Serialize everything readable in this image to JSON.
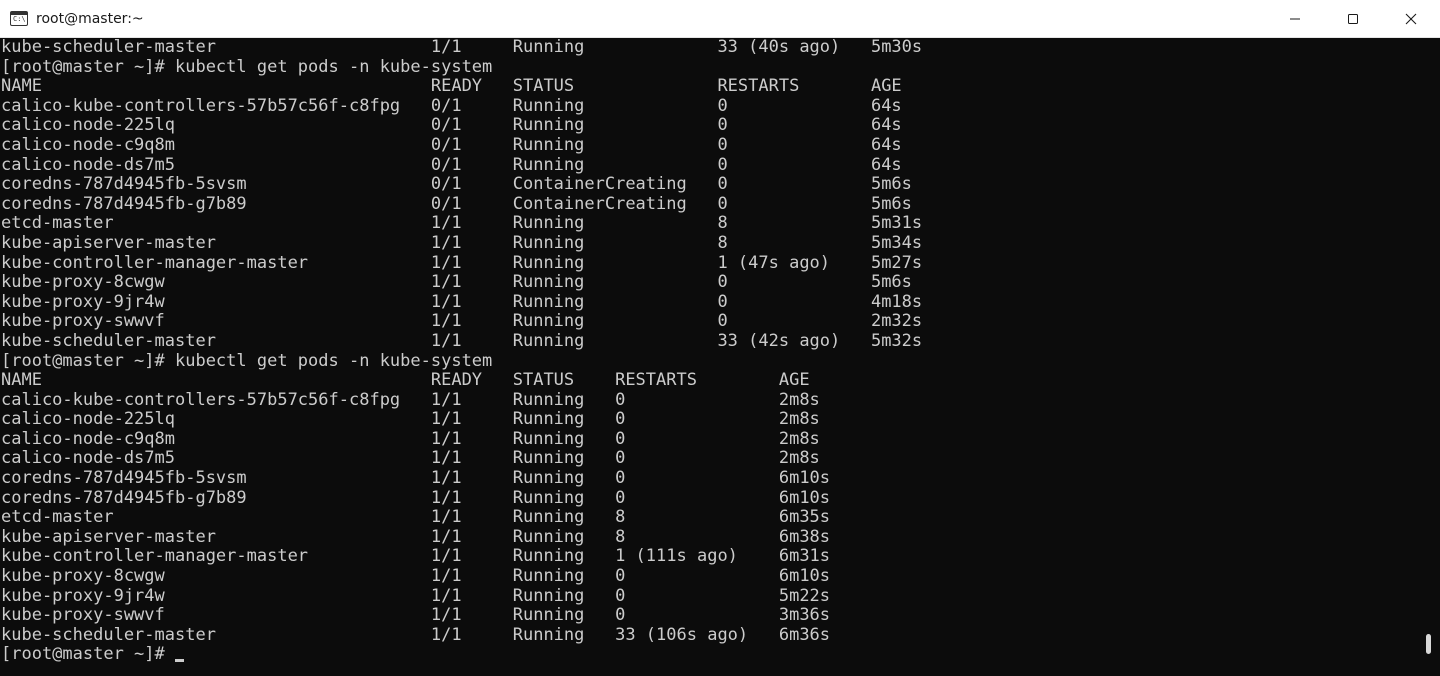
{
  "window": {
    "title": "root@master:~",
    "icon": "terminal-icon",
    "icon_glyph": "C:\\",
    "controls": [
      "minimize-icon",
      "maximize-icon",
      "close-icon"
    ]
  },
  "colors": {
    "background": "#0c0c0c",
    "foreground": "#cccccc",
    "titlebar": "#ffffff"
  },
  "terminal": {
    "lines": [
      "kube-scheduler-master                     1/1     Running             33 (40s ago)   5m30s",
      "[root@master ~]# kubectl get pods -n kube-system",
      "NAME                                      READY   STATUS              RESTARTS       AGE",
      "calico-kube-controllers-57b57c56f-c8fpg   0/1     Running             0              64s",
      "calico-node-225lq                         0/1     Running             0              64s",
      "calico-node-c9q8m                         0/1     Running             0              64s",
      "calico-node-ds7m5                         0/1     Running             0              64s",
      "coredns-787d4945fb-5svsm                  0/1     ContainerCreating   0              5m6s",
      "coredns-787d4945fb-g7b89                  0/1     ContainerCreating   0              5m6s",
      "etcd-master                               1/1     Running             8              5m31s",
      "kube-apiserver-master                     1/1     Running             8              5m34s",
      "kube-controller-manager-master            1/1     Running             1 (47s ago)    5m27s",
      "kube-proxy-8cwgw                          1/1     Running             0              5m6s",
      "kube-proxy-9jr4w                          1/1     Running             0              4m18s",
      "kube-proxy-swwvf                          1/1     Running             0              2m32s",
      "kube-scheduler-master                     1/1     Running             33 (42s ago)   5m32s",
      "[root@master ~]# kubectl get pods -n kube-system",
      "NAME                                      READY   STATUS    RESTARTS        AGE",
      "calico-kube-controllers-57b57c56f-c8fpg   1/1     Running   0               2m8s",
      "calico-node-225lq                         1/1     Running   0               2m8s",
      "calico-node-c9q8m                         1/1     Running   0               2m8s",
      "calico-node-ds7m5                         1/1     Running   0               2m8s",
      "coredns-787d4945fb-5svsm                  1/1     Running   0               6m10s",
      "coredns-787d4945fb-g7b89                  1/1     Running   0               6m10s",
      "etcd-master                               1/1     Running   8               6m35s",
      "kube-apiserver-master                     1/1     Running   8               6m38s",
      "kube-controller-manager-master            1/1     Running   1 (111s ago)    6m31s",
      "kube-proxy-8cwgw                          1/1     Running   0               6m10s",
      "kube-proxy-9jr4w                          1/1     Running   0               5m22s",
      "kube-proxy-swwvf                          1/1     Running   0               3m36s",
      "kube-scheduler-master                     1/1     Running   33 (106s ago)   6m36s"
    ],
    "prompt": "[root@master ~]#"
  }
}
